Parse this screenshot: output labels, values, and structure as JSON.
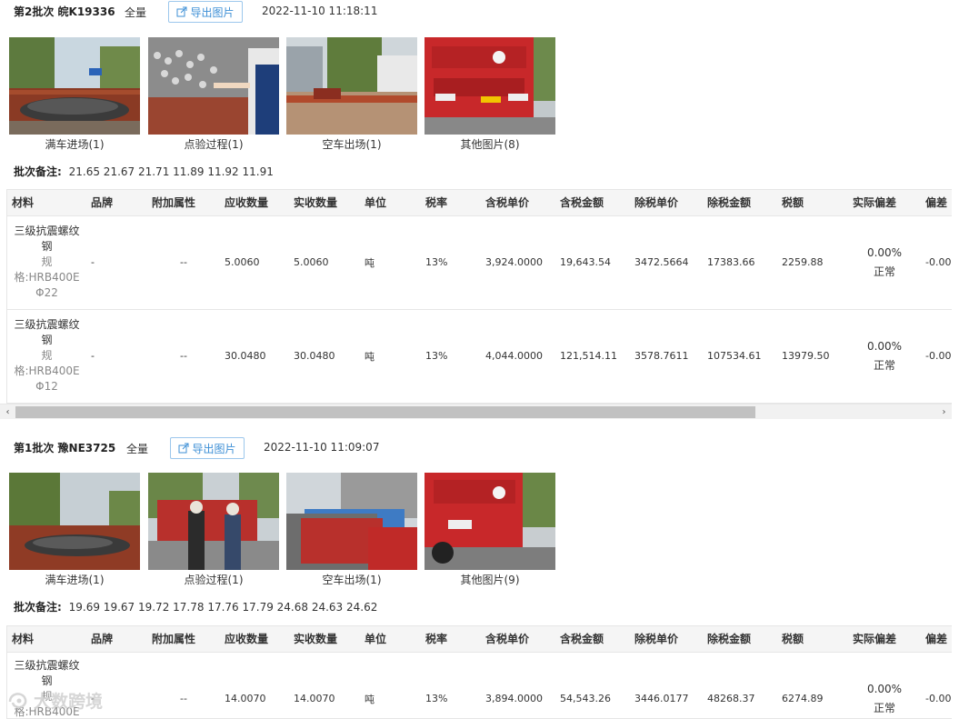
{
  "batches": [
    {
      "title": "第2批次 皖K19336",
      "qty_label": "全量",
      "export_label": "导出图片",
      "time": "2022-11-10 11:18:11",
      "photos": [
        {
          "caption": "满车进场(1)"
        },
        {
          "caption": "点验过程(1)"
        },
        {
          "caption": "空车出场(1)"
        },
        {
          "caption": "其他图片(8)"
        }
      ],
      "remark_label": "批次备注:",
      "remark_value": "21.65 21.67 21.71 11.89 11.92 11.91",
      "columns": [
        "材料",
        "品牌",
        "附加属性",
        "应收数量",
        "实收数量",
        "单位",
        "税率",
        "含税单价",
        "含税金额",
        "除税单价",
        "除税金额",
        "税额",
        "实际偏差",
        "偏差"
      ],
      "rows": [
        {
          "name": "三级抗震螺纹钢",
          "spec": "规格:HRB400E Φ22",
          "brand": "-",
          "attr": "--",
          "due": "5.0060",
          "recv": "5.0060",
          "unit": "吨",
          "rate": "13%",
          "price_tax": "3,924.0000",
          "amount_tax": "19,643.54",
          "price_net": "3472.5664",
          "amount_net": "17383.66",
          "tax": "2259.88",
          "dev_pct": "0.00%",
          "dev_status": "正常",
          "dev2": "-0.00"
        },
        {
          "name": "三级抗震螺纹钢",
          "spec": "规格:HRB400E Φ12",
          "brand": "-",
          "attr": "--",
          "due": "30.0480",
          "recv": "30.0480",
          "unit": "吨",
          "rate": "13%",
          "price_tax": "4,044.0000",
          "amount_tax": "121,514.11",
          "price_net": "3578.7611",
          "amount_net": "107534.61",
          "tax": "13979.50",
          "dev_pct": "0.00%",
          "dev_status": "正常",
          "dev2": "-0.00"
        }
      ]
    },
    {
      "title": "第1批次 豫NE3725",
      "qty_label": "全量",
      "export_label": "导出图片",
      "time": "2022-11-10 11:09:07",
      "photos": [
        {
          "caption": "满车进场(1)"
        },
        {
          "caption": "点验过程(1)"
        },
        {
          "caption": "空车出场(1)"
        },
        {
          "caption": "其他图片(9)"
        }
      ],
      "remark_label": "批次备注:",
      "remark_value": "19.69 19.67 19.72 17.78 17.76 17.79 24.68 24.63 24.62",
      "columns": [
        "材料",
        "品牌",
        "附加属性",
        "应收数量",
        "实收数量",
        "单位",
        "税率",
        "含税单价",
        "含税金额",
        "除税单价",
        "除税金额",
        "税额",
        "实际偏差",
        "偏差"
      ],
      "rows": [
        {
          "name": "三级抗震螺纹钢",
          "spec": "规格:HRB400E",
          "brand": "-",
          "attr": "--",
          "due": "14.0070",
          "recv": "14.0070",
          "unit": "吨",
          "rate": "13%",
          "price_tax": "3,894.0000",
          "amount_tax": "54,543.26",
          "price_net": "3446.0177",
          "amount_net": "48268.37",
          "tax": "6274.89",
          "dev_pct": "0.00%",
          "dev_status": "正常",
          "dev2": "-0.00"
        }
      ]
    }
  ],
  "scroll": {
    "left_arrow": "‹",
    "right_arrow": "›"
  },
  "watermark": "大数跨境",
  "colors": {
    "accent": "#3d8fd6",
    "header_bg": "#f5f5f5",
    "truck_red": "#c8282a",
    "border": "#e6e6e6"
  }
}
